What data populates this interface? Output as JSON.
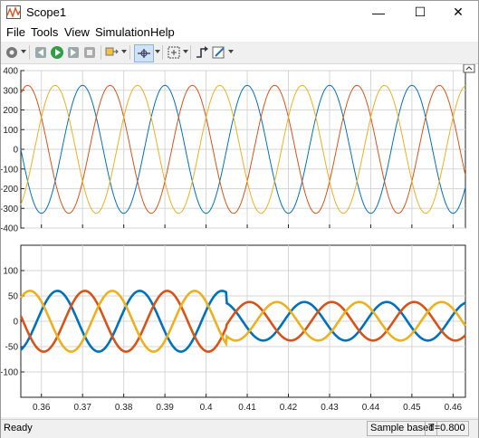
{
  "window": {
    "title": "Scope1",
    "minimize": "—",
    "maximize": "☐",
    "close": "✕"
  },
  "menus": [
    "File",
    "Tools",
    "View",
    "Simulation",
    "Help"
  ],
  "toolbar": {
    "icons": [
      "settings-icon",
      "step-back-icon",
      "run-icon",
      "step-forward-icon",
      "stop-icon",
      "highlight-block-icon",
      "zoom-icon",
      "autoscale-icon",
      "triggers-icon",
      "style-icon"
    ]
  },
  "status": {
    "state": "Ready",
    "mode": "Sample based",
    "time": "T=0.800"
  },
  "colors": {
    "phase_a": "#0072BD",
    "phase_b": "#D95319",
    "phase_c": "#EDB120"
  },
  "chart_data": [
    {
      "type": "line",
      "title": "",
      "x_range": [
        0.355,
        0.463
      ],
      "ylim": [
        -400,
        400
      ],
      "yticks": [
        "400",
        "300",
        "200",
        "100",
        "0",
        "-100",
        "-200",
        "-300",
        "-400"
      ],
      "grid": true,
      "series": [
        {
          "color": "#0072BD",
          "amplitude": 325,
          "frequency_hz": 50,
          "phase_deg": -90
        },
        {
          "color": "#D95319",
          "amplitude": 325,
          "frequency_hz": 50,
          "phase_deg": 150
        },
        {
          "color": "#EDB120",
          "amplitude": 325,
          "frequency_hz": 50,
          "phase_deg": 30
        }
      ]
    },
    {
      "type": "line",
      "title": "",
      "x_range": [
        0.355,
        0.463
      ],
      "ylim": [
        -150,
        150
      ],
      "yticks": [
        "100",
        "50",
        "0",
        "-50",
        "-100"
      ],
      "xticks": [
        "0.36",
        "0.37",
        "0.38",
        "0.39",
        "0.4",
        "0.41",
        "0.42",
        "0.43",
        "0.44",
        "0.45",
        "0.46"
      ],
      "grid": true,
      "step_time": 0.405,
      "series": [
        {
          "color": "#0072BD",
          "amplitude_before": 60,
          "amplitude_after": 38,
          "frequency_hz": 50,
          "phase_deg": 20
        },
        {
          "color": "#D95319",
          "amplitude_before": 60,
          "amplitude_after": 38,
          "frequency_hz": 50,
          "phase_deg": -100
        },
        {
          "color": "#EDB120",
          "amplitude_before": 60,
          "amplitude_after": 38,
          "frequency_hz": 50,
          "phase_deg": 140
        }
      ]
    }
  ]
}
